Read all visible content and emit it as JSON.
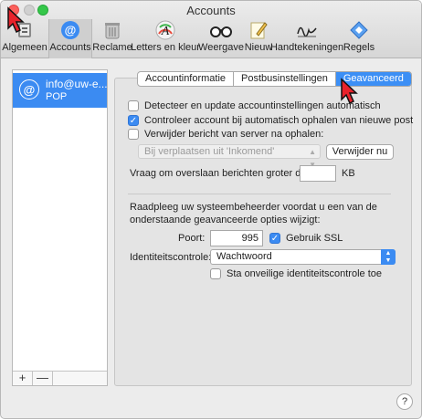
{
  "window": {
    "title": "Accounts"
  },
  "toolbar": {
    "items": [
      {
        "label": "Algemeen",
        "icon": "general-icon"
      },
      {
        "label": "Accounts",
        "icon": "at-sign-icon"
      },
      {
        "label": "Reclame",
        "icon": "trash-icon"
      },
      {
        "label": "Letters en kleur",
        "icon": "fonts-colors-icon"
      },
      {
        "label": "Weergave",
        "icon": "glasses-icon"
      },
      {
        "label": "Nieuw",
        "icon": "pencil-note-icon"
      },
      {
        "label": "Handtekeningen",
        "icon": "signature-icon"
      },
      {
        "label": "Regels",
        "icon": "rules-icon"
      }
    ]
  },
  "sidebar": {
    "account": {
      "name": "info@uw-e...",
      "type": "POP"
    },
    "add_label": "+",
    "remove_label": "—"
  },
  "tabs": [
    "Accountinformatie",
    "Postbusinstellingen",
    "Geavanceerd"
  ],
  "advanced": {
    "detect_label": "Detecteer en update accountinstellingen automatisch",
    "detect_checked": false,
    "check_label": "Controleer account bij automatisch ophalen van nieuwe post",
    "check_checked": true,
    "remove_label": "Verwijder bericht van server na ophalen:",
    "remove_checked": false,
    "remove_option": "Bij verplaatsen uit 'Inkomend'",
    "remove_now_button": "Verwijder nu",
    "skip_label": "Vraag om overslaan berichten groter dan",
    "skip_value": "",
    "skip_unit": "KB",
    "admin_note_line1": "Raadpleeg uw systeembeheerder voordat u een van de",
    "admin_note_line2": "onderstaande geavanceerde opties wijzigt:",
    "port_label": "Poort:",
    "port_value": "995",
    "ssl_label": "Gebruik SSL",
    "ssl_checked": true,
    "auth_label": "Identiteitscontrole:",
    "auth_value": "Wachtwoord",
    "insecure_label": "Sta onveilige identiteitscontrole toe",
    "insecure_checked": false
  },
  "help_label": "?"
}
